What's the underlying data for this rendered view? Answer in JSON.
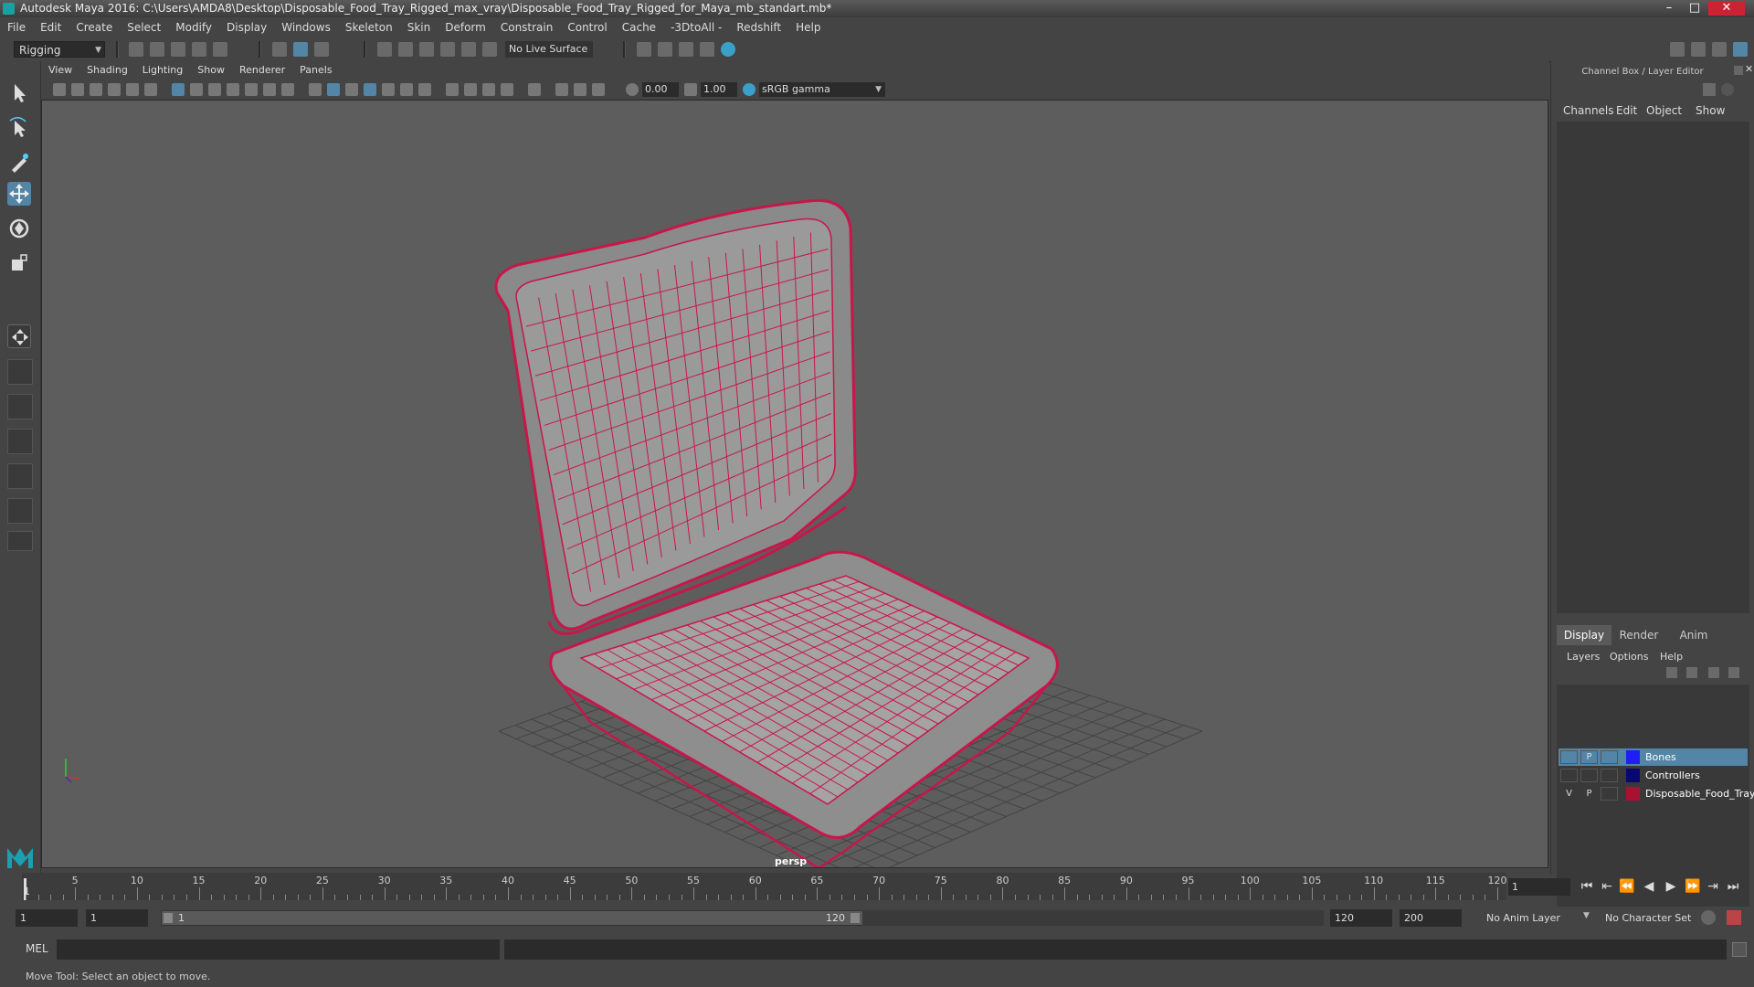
{
  "window": {
    "title": "Autodesk Maya 2016: C:\\Users\\AMDA8\\Desktop\\Disposable_Food_Tray_Rigged_max_vray\\Disposable_Food_Tray_Rigged_for_Maya_mb_standart.mb*",
    "minimize": "–",
    "maximize": "□",
    "close": "✕"
  },
  "menubar": [
    "File",
    "Edit",
    "Create",
    "Select",
    "Modify",
    "Display",
    "Windows",
    "Skeleton",
    "Skin",
    "Deform",
    "Constrain",
    "Control",
    "Cache",
    "-3DtoAll -",
    "Redshift",
    "Help"
  ],
  "toolbar": {
    "mode": "Rigging",
    "live_surface": "No Live Surface"
  },
  "viewport": {
    "menus": [
      "View",
      "Shading",
      "Lighting",
      "Show",
      "Renderer",
      "Panels"
    ],
    "exposure": "0.00",
    "gamma": "1.00",
    "color_space": "sRGB gamma",
    "camera_label": "persp"
  },
  "channel_box": {
    "title": "Channel Box / Layer Editor",
    "tabs": [
      "Channels",
      "Edit",
      "Object",
      "Show"
    ]
  },
  "layer_editor": {
    "tabs": [
      "Display",
      "Render",
      "Anim"
    ],
    "menus": [
      "Layers",
      "Options",
      "Help"
    ],
    "layers": [
      {
        "v": "",
        "p": "P",
        "name": "Bones",
        "color": "#1f1ff5",
        "selected": true
      },
      {
        "v": "",
        "p": "",
        "name": "Controllers",
        "color": "#080870",
        "selected": false
      },
      {
        "v": "V",
        "p": "P",
        "name": "Disposable_Food_Tray",
        "color": "#a8112f",
        "selected": false
      }
    ]
  },
  "timeline": {
    "ticks": [
      "5",
      "10",
      "15",
      "20",
      "25",
      "30",
      "35",
      "40",
      "45",
      "50",
      "55",
      "60",
      "65",
      "70",
      "75",
      "80",
      "85",
      "90",
      "95",
      "100",
      "105",
      "110",
      "115",
      "120"
    ],
    "start_label": "1",
    "current_frame": "1"
  },
  "range": {
    "start": "1",
    "playback_start": "1",
    "slider_start": "1",
    "slider_end": "120",
    "playback_end": "120",
    "end": "200",
    "anim_layer": "No Anim Layer",
    "character_set": "No Character Set"
  },
  "command_line": {
    "label": "MEL"
  },
  "help_line": "Move Tool: Select an object to move.",
  "colors": {
    "wireframe": "#c8164a",
    "accent": "#5285a6"
  }
}
